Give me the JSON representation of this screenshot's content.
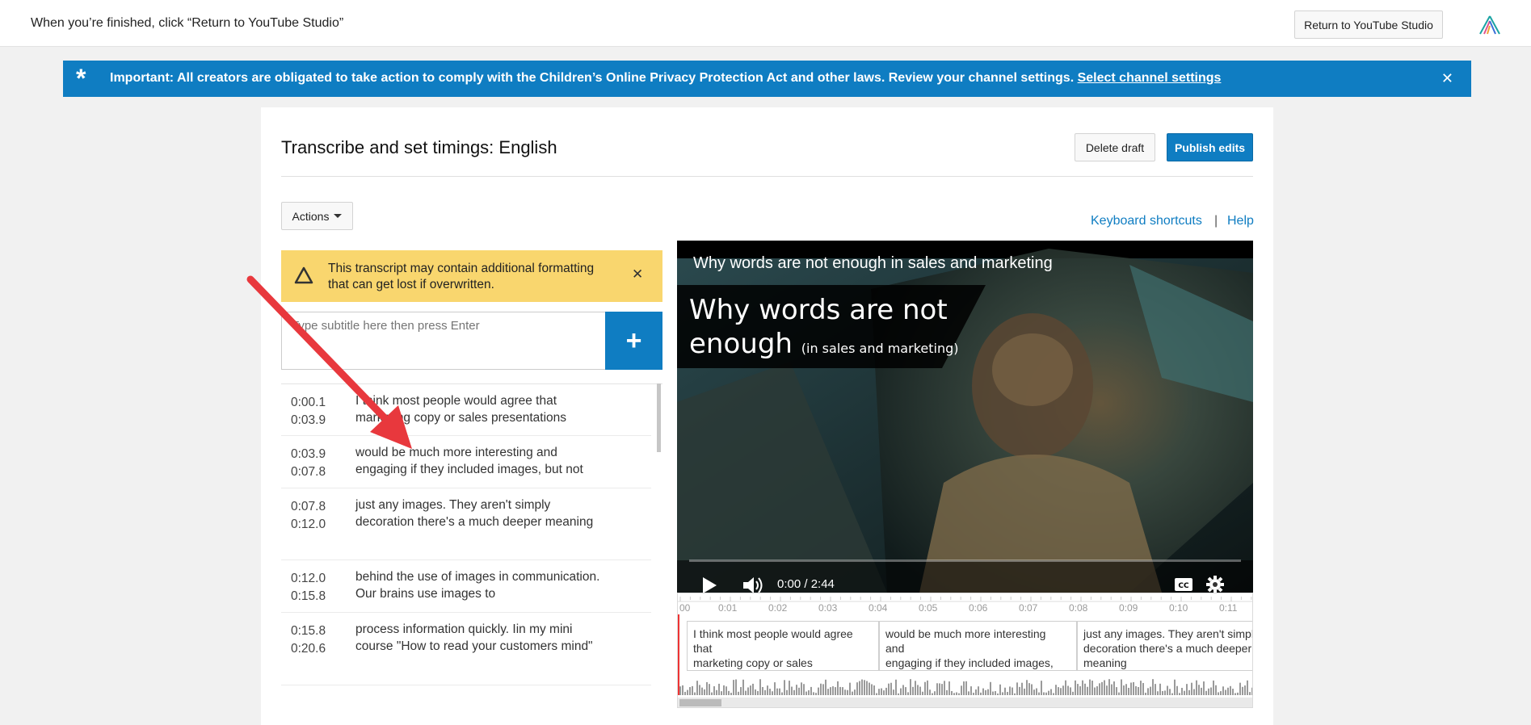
{
  "topbar": {
    "message": "When you’re finished, click “Return to YouTube Studio”",
    "return_label": "Return to YouTube Studio"
  },
  "banner": {
    "text": "Important: All creators are obligated to take action to comply with the Children’s Online Privacy Protection Act and other laws. Review your channel settings.",
    "link": "Select channel settings",
    "color": "#0f7dc2"
  },
  "editor": {
    "title": "Transcribe and set timings: English",
    "delete_label": "Delete draft",
    "publish_label": "Publish edits",
    "actions_label": "Actions",
    "keyboard_shortcuts": "Keyboard shortcuts",
    "separator": "|",
    "help": "Help"
  },
  "warning": {
    "text": "This transcript may contain additional formatting that can get lost if overwritten.",
    "color": "#f9d66e"
  },
  "input": {
    "placeholder": "Type subtitle here then press Enter",
    "value": ""
  },
  "captions": [
    {
      "start": "0:00.1",
      "end": "0:03.9",
      "text": "I think most people would agree that marketing copy or sales presentations"
    },
    {
      "start": "0:03.9",
      "end": "0:07.8",
      "text": "would be much more interesting and engaging if they included images, but not"
    },
    {
      "start": "0:07.8",
      "end": "0:12.0",
      "text": "just any images. They aren't simply decoration there's a much deeper meaning"
    },
    {
      "start": "0:12.0",
      "end": "0:15.8",
      "text": "behind the use of images in communication. Our brains use images to"
    },
    {
      "start": "0:15.8",
      "end": "0:20.6",
      "text": "process information quickly. Iin my mini course \"How to read your customers mind\""
    }
  ],
  "video": {
    "title": "Why words are not enough in sales and marketing",
    "overlay_line1": "Why words are not",
    "overlay_line2": "enough",
    "overlay_small": "(in sales and marketing)",
    "time": "0:00 / 2:44"
  },
  "timeline": {
    "ticks": [
      "00",
      "0:01",
      "0:02",
      "0:03",
      "0:04",
      "0:05",
      "0:06",
      "0:07",
      "0:08",
      "0:09",
      "0:10",
      "0:11"
    ],
    "cues": [
      {
        "line1": "I think most people would agree",
        "line2": "that",
        "line3": "marketing copy or sales"
      },
      {
        "line1": "would be much more interesting",
        "line2": "and",
        "line3": "engaging if they included images,"
      },
      {
        "line1": "just any images. They aren't simply",
        "line2": "decoration there's a much deeper",
        "line3": "meaning"
      }
    ]
  }
}
